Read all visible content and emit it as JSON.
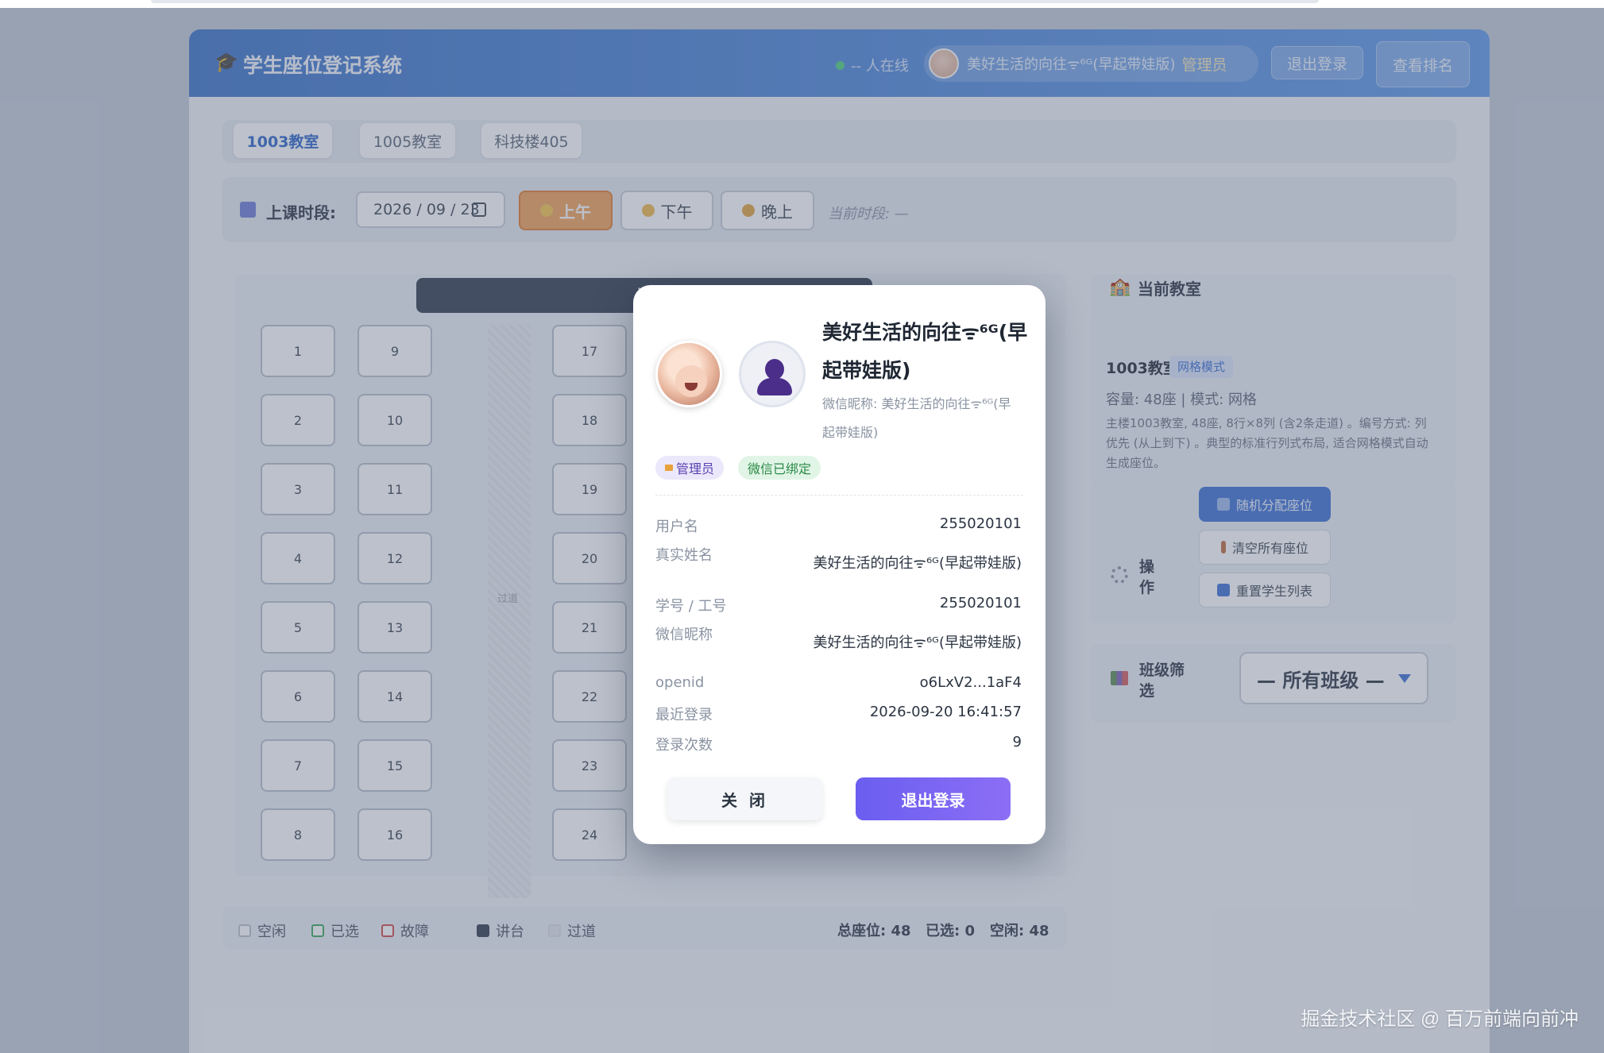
{
  "app": {
    "title": "学生座位登记系统",
    "online_text": "-- 人在线",
    "user_name": "美好生活的向往ᯤ⁶ᴳ(早起带娃版)",
    "user_role": "管理员",
    "logout_label": "退出登录",
    "ranking_label": "查看排名"
  },
  "tabs": [
    {
      "label": "1003教室",
      "active": true
    },
    {
      "label": "1005教室",
      "active": false
    },
    {
      "label": "科技楼405",
      "active": false
    }
  ],
  "period": {
    "label": "上课时段:",
    "date": "2026 / 09 / 23",
    "morning": "上午",
    "afternoon": "下午",
    "evening": "晚上",
    "current": "当前时段: —"
  },
  "seating": {
    "podium": "讲",
    "aisle_label": "过道",
    "seats": [
      "1",
      "2",
      "3",
      "4",
      "5",
      "6",
      "7",
      "8",
      "9",
      "10",
      "11",
      "12",
      "13",
      "14",
      "15",
      "16",
      "17",
      "18",
      "19",
      "20",
      "21",
      "22",
      "23",
      "24"
    ]
  },
  "legend": {
    "free": "空闲",
    "selected": "已选",
    "broken": "故障",
    "podium": "讲台",
    "aisle": "过道",
    "total": "总座位: 48",
    "chosen": "已选: 0",
    "idle": "空闲: 48"
  },
  "sidebar": {
    "current_title": "当前教室",
    "room_name": "1003教室",
    "mode_badge": "网格模式",
    "capacity": "容量: 48座 | 模式: 网格",
    "description": "主楼1003教室, 48座, 8行×8列 (含2条走道) 。编号方式: 列优先 (从上到下) 。典型的标准行列式布局, 适合网格模式自动生成座位。",
    "ops_title": "操作",
    "op_random": "随机分配座位",
    "op_clear": "清空所有座位",
    "op_reset": "重置学生列表",
    "class_title": "班级筛选",
    "class_selected": "— 所有班级 —"
  },
  "modal": {
    "name": "美好生活的向往ᯤ⁶ᴳ(早起带娃版)",
    "nickname": "微信昵称: 美好生活的向往ᯤ⁶ᴳ(早起带娃版)",
    "badge_admin": "管理员",
    "badge_wechat": "微信已绑定",
    "rows": [
      {
        "key": "用户名",
        "value": "255020101"
      },
      {
        "key": "真实姓名",
        "value": "美好生活的向往ᯤ⁶ᴳ(早起带娃版)"
      },
      {
        "key": "学号 / 工号",
        "value": "255020101"
      },
      {
        "key": "微信昵称",
        "value": "美好生活的向往ᯤ⁶ᴳ(早起带娃版)"
      },
      {
        "key": "openid",
        "value": "o6LxV2...1aF4"
      },
      {
        "key": "最近登录",
        "value": "2026-09-20 16:41:57"
      },
      {
        "key": "登录次数",
        "value": "9"
      }
    ],
    "close_label": "关 闭",
    "logout_label": "退出登录"
  },
  "watermark": "掘金技术社区 @ 百万前端向前冲",
  "colors": {
    "header": "#3a72c8",
    "accent_orange": "#f3a055",
    "primary_purple": "#6a5ef0",
    "primary_blue": "#3b6fd4"
  }
}
